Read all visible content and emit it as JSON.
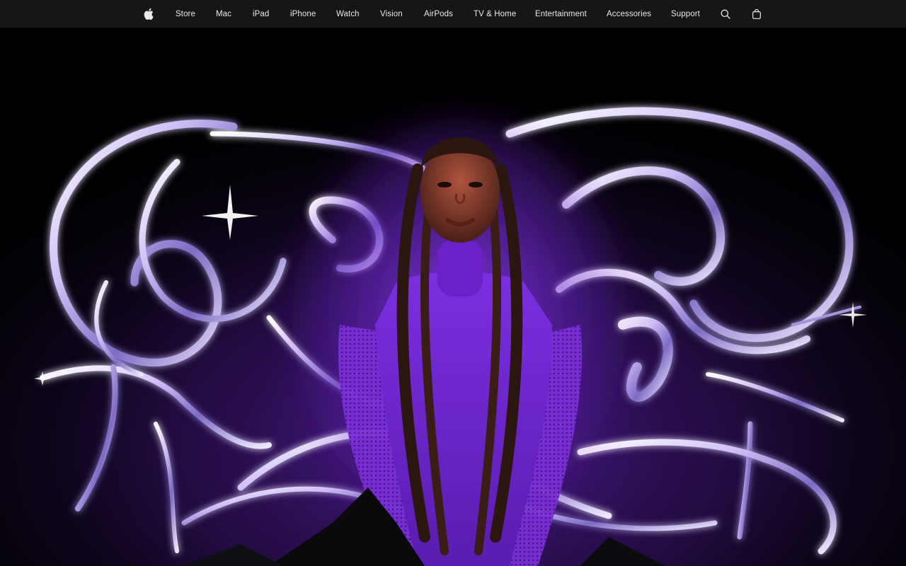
{
  "nav": {
    "apple_logo": "apple-logo-icon",
    "items": [
      {
        "label": "Store"
      },
      {
        "label": "Mac"
      },
      {
        "label": "iPad"
      },
      {
        "label": "iPhone"
      },
      {
        "label": "Watch"
      },
      {
        "label": "Vision"
      },
      {
        "label": "AirPods"
      },
      {
        "label": "TV & Home"
      },
      {
        "label": "Entertainment"
      },
      {
        "label": "Accessories"
      },
      {
        "label": "Support"
      }
    ],
    "search_icon": "search-icon",
    "bag_icon": "shopping-bag-icon"
  },
  "colors": {
    "nav_background": "#161617",
    "nav_text": "#e8e8ed",
    "hero_background": "#000000",
    "accent_purple": "#7a2fd6",
    "chrome_highlight": "#e6dcff"
  }
}
